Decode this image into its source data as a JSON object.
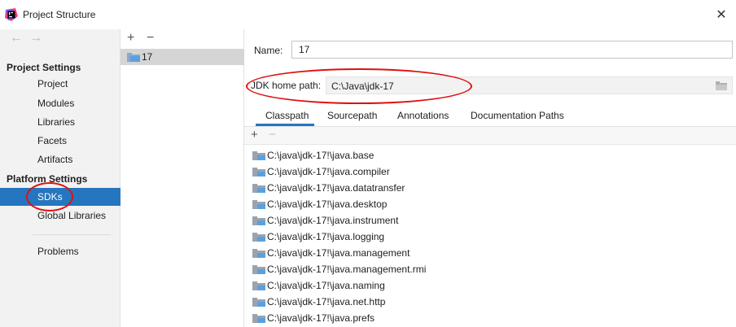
{
  "window": {
    "title": "Project Structure",
    "close_glyph": "✕"
  },
  "colors": {
    "accent": "#2675bf",
    "annotation": "#e01010"
  },
  "sidebar": {
    "back_glyph": "←",
    "forward_glyph": "→",
    "project_settings_header": "Project Settings",
    "project_items": [
      {
        "label": "Project"
      },
      {
        "label": "Modules"
      },
      {
        "label": "Libraries"
      },
      {
        "label": "Facets"
      },
      {
        "label": "Artifacts"
      }
    ],
    "platform_settings_header": "Platform Settings",
    "platform_items": [
      {
        "label": "SDKs",
        "selected": true
      },
      {
        "label": "Global Libraries"
      }
    ],
    "other_items": [
      {
        "label": "Problems"
      }
    ]
  },
  "sdk_list": {
    "add_glyph": "+",
    "remove_glyph": "−",
    "items": [
      {
        "name": "17"
      }
    ]
  },
  "detail": {
    "name_label": "Name:",
    "name_value": "17",
    "jdk_home_label": "JDK home path:",
    "jdk_home_value": "C:\\Java\\jdk-17",
    "tabs": [
      {
        "label": "Classpath",
        "active": true
      },
      {
        "label": "Sourcepath"
      },
      {
        "label": "Annotations"
      },
      {
        "label": "Documentation Paths"
      }
    ],
    "classpath_add_glyph": "+",
    "classpath_remove_glyph": "−",
    "classpath_entries": [
      "C:\\java\\jdk-17!\\java.base",
      "C:\\java\\jdk-17!\\java.compiler",
      "C:\\java\\jdk-17!\\java.datatransfer",
      "C:\\java\\jdk-17!\\java.desktop",
      "C:\\java\\jdk-17!\\java.instrument",
      "C:\\java\\jdk-17!\\java.logging",
      "C:\\java\\jdk-17!\\java.management",
      "C:\\java\\jdk-17!\\java.management.rmi",
      "C:\\java\\jdk-17!\\java.naming",
      "C:\\java\\jdk-17!\\java.net.http",
      "C:\\java\\jdk-17!\\java.prefs"
    ]
  }
}
